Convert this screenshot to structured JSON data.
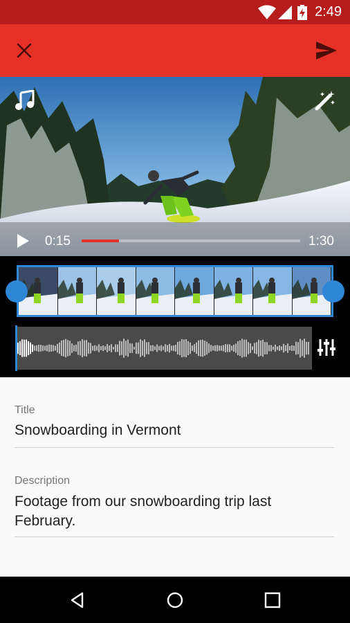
{
  "status": {
    "time": "2:49"
  },
  "toolbar": {
    "close_icon": "close-icon",
    "send_icon": "send-icon"
  },
  "video": {
    "current_time": "0:15",
    "duration": "1:30",
    "progress_fraction": 0.17,
    "music_icon": "music-note-icon",
    "effects_icon": "magic-wand-icon"
  },
  "editor": {
    "frame_count": 8,
    "mixer_icon": "equalizer-icon"
  },
  "form": {
    "title_label": "Title",
    "title_value": "Snowboarding in Vermont",
    "description_label": "Description",
    "description_value": "Footage from our snowboarding trip last February."
  },
  "colors": {
    "accent": "#e53127",
    "status_bar": "#b71c1c",
    "selection": "#2f86d6"
  }
}
